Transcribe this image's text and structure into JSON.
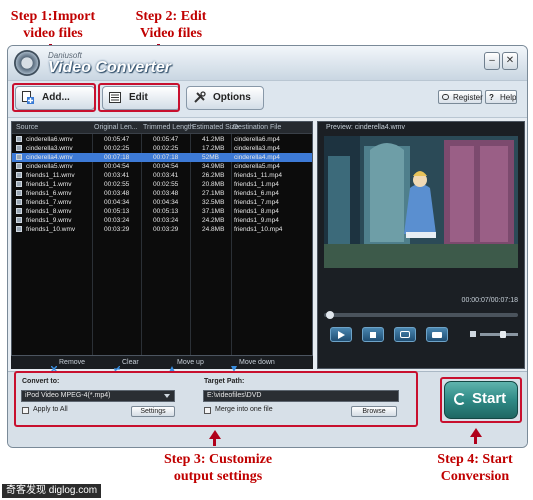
{
  "annotations": {
    "step1": "Step 1:Import video files",
    "step2": "Step 2: Edit Video files",
    "step3": "Step 3: Customize output settings",
    "step4": "Step 4: Start Conversion"
  },
  "app": {
    "brand": "Daniusoft",
    "title": "Video Converter"
  },
  "toolbar": {
    "add_label": "Add...",
    "edit_label": "Edit",
    "options_label": "Options",
    "register_label": "Register",
    "help_label": "Help"
  },
  "file_list": {
    "columns": [
      "Source",
      "Original Len...",
      "Trimmed Length",
      "Estimated Size",
      "Destination File"
    ],
    "rows": [
      [
        "cinderella6.wmv",
        "00:05:47",
        "00:05:47",
        "41.2MB",
        "cinderella6.mp4"
      ],
      [
        "cinderella3.wmv",
        "00:02:25",
        "00:02:25",
        "17.2MB",
        "cinderella3.mp4"
      ],
      [
        "cinderella4.wmv",
        "00:07:18",
        "00:07:18",
        "52MB",
        "cinderella4.mp4"
      ],
      [
        "cinderella5.wmv",
        "00:04:54",
        "00:04:54",
        "34.9MB",
        "cinderella5.mp4"
      ],
      [
        "friends1_11.wmv",
        "00:03:41",
        "00:03:41",
        "26.2MB",
        "friends1_11.mp4"
      ],
      [
        "friends1_1.wmv",
        "00:02:55",
        "00:02:55",
        "20.8MB",
        "friends1_1.mp4"
      ],
      [
        "friends1_6.wmv",
        "00:03:48",
        "00:03:48",
        "27.1MB",
        "friends1_6.mp4"
      ],
      [
        "friends1_7.wmv",
        "00:04:34",
        "00:04:34",
        "32.5MB",
        "friends1_7.mp4"
      ],
      [
        "friends1_8.wmv",
        "00:05:13",
        "00:05:13",
        "37.1MB",
        "friends1_8.mp4"
      ],
      [
        "friends1_9.wmv",
        "00:03:24",
        "00:03:24",
        "24.2MB",
        "friends1_9.mp4"
      ],
      [
        "friends1_10.wmv",
        "00:03:29",
        "00:03:29",
        "24.8MB",
        "friends1_10.mp4"
      ]
    ],
    "selected_index": 2,
    "footer": {
      "remove": "Remove",
      "clear": "Clear",
      "move_up": "Move up",
      "move_down": "Move down"
    }
  },
  "preview": {
    "label": "Preview: cinderella4.wmv",
    "time": "00:00:07/00:07:18"
  },
  "output": {
    "convert_to_label": "Convert to:",
    "format_value": "iPod Video MPEG-4(*.mp4)",
    "apply_to_all": "Apply to All",
    "settings_label": "Settings",
    "target_path_label": "Target Path:",
    "target_path_value": "E:\\videofiles\\DVD",
    "merge_label": "Merge into one file",
    "browse_label": "Browse"
  },
  "start": {
    "label": "Start"
  },
  "watermark": "奇客发现 diglog.com",
  "colors": {
    "annotation_red": "#c00000",
    "selection_blue": "#3d7ad6",
    "start_green": "#2f8a86"
  }
}
